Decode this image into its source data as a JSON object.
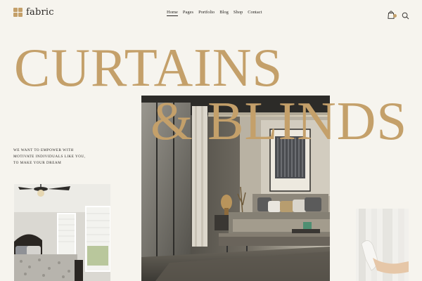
{
  "brand": {
    "name": "fabric"
  },
  "nav": {
    "items": [
      {
        "label": "Home",
        "active": true
      },
      {
        "label": "Pages",
        "active": false
      },
      {
        "label": "Portfolio",
        "active": false
      },
      {
        "label": "Blog",
        "active": false
      },
      {
        "label": "Shop",
        "active": false
      },
      {
        "label": "Contact",
        "active": false
      }
    ]
  },
  "header_icons": {
    "cart": "shopping-bag-icon",
    "search": "search-icon"
  },
  "hero": {
    "title_line1": "CURTAINS",
    "title_line2": "& BLINDS",
    "tagline": [
      "WE WANT TO EMPOWER WITH",
      "MOTIVATE INDIVIDUALS LIKE YOU,",
      "TO MAKE YOUR DREAM"
    ]
  },
  "colors": {
    "accent": "#c4a06a",
    "background": "#f6f4ee",
    "text": "#2a2724"
  }
}
